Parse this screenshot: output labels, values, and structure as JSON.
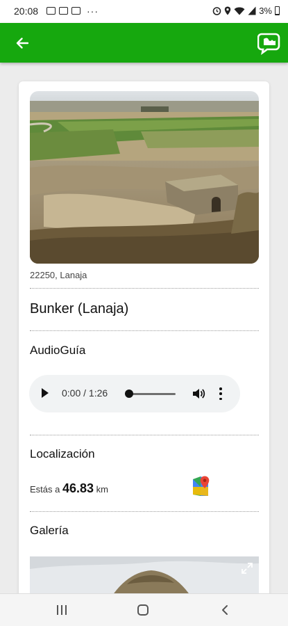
{
  "status_bar": {
    "time": "20:08",
    "more": "···",
    "battery": "3%"
  },
  "app_bar": {
    "back_icon": "arrow-left-icon",
    "logo_icon": "app-logo-icon",
    "color": "#16a80e"
  },
  "place": {
    "image_icon": "bunker-photo",
    "address": "22250, Lanaja",
    "title": "Bunker (Lanaja)"
  },
  "audio_guide": {
    "label": "AudioGuía",
    "time": "0:00 / 1:26",
    "progress": 0
  },
  "location": {
    "label": "Localización",
    "distance_prefix": "Estás a",
    "distance_value": "46.83",
    "distance_unit": "km",
    "maps_icon": "google-maps-icon"
  },
  "gallery": {
    "label": "Galería",
    "expand_icon": "expand-icon"
  },
  "nav_bar": {
    "recent_icon": "recent-apps-icon",
    "home_icon": "home-icon",
    "back_icon": "back-chevron-icon"
  }
}
